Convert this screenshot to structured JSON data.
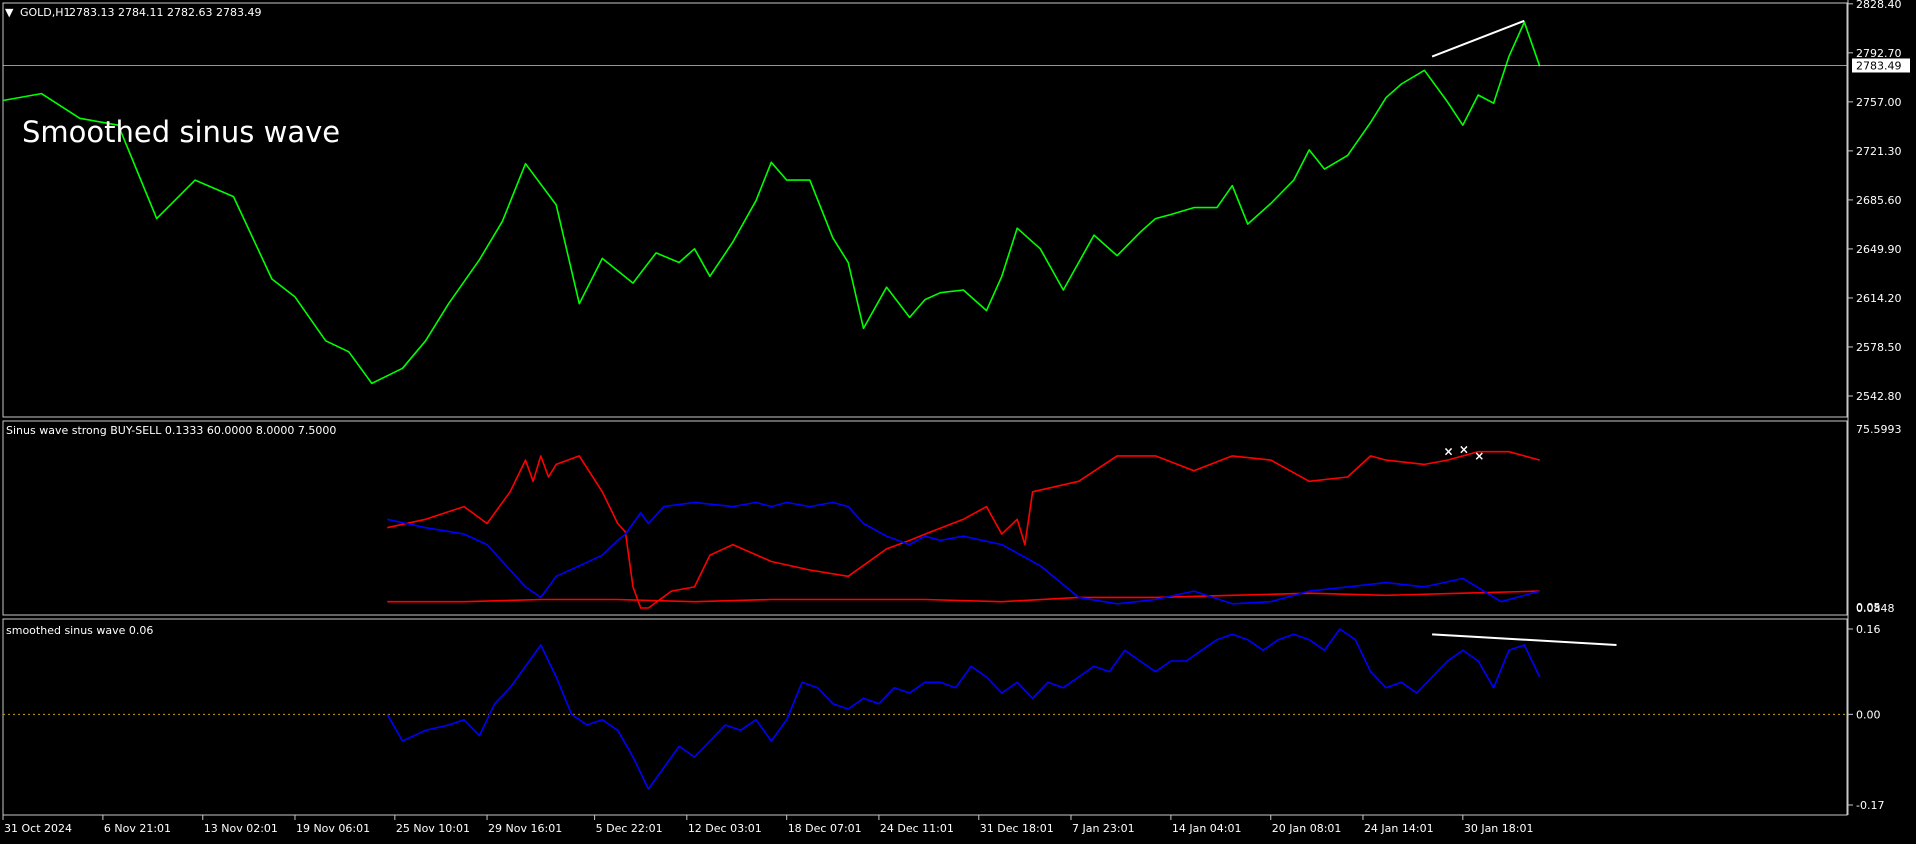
{
  "header": {
    "menu_triangle": "▼",
    "symbol": "GOLD,H1",
    "ohlc": "2783.13 2784.11 2782.63 2783.49"
  },
  "overlay_text": "Smoothed sinus wave",
  "colors": {
    "background": "#000000",
    "price": "#00ff00",
    "sell": "#ff0000",
    "buy": "#0000ff",
    "smoothed": "#0000ff",
    "axis_text": "#ffffff",
    "frame": "#c8c8c8",
    "zero_line": "#c8a000",
    "trend_line": "#ffffff"
  },
  "chart_data": [
    {
      "type": "line",
      "name": "price-panel",
      "title": "GOLD,H1",
      "ylim": [
        2527.5,
        2829
      ],
      "y_ticks": [
        "2828.40",
        "2792.70",
        "2757.00",
        "2721.30",
        "2685.60",
        "2649.90",
        "2614.20",
        "2578.50",
        "2542.80"
      ],
      "current_price": "2783.49",
      "series": [
        {
          "name": "GOLD,H1",
          "x": [
            0,
            5,
            10,
            15,
            20,
            25,
            30,
            35,
            38,
            42,
            45,
            48,
            52,
            55,
            58,
            62,
            65,
            68,
            72,
            75,
            78,
            82,
            85,
            88,
            90,
            92,
            95,
            98,
            100,
            102,
            105,
            108,
            110,
            112,
            115,
            118,
            120,
            122,
            125,
            128,
            130,
            132,
            135,
            138,
            140,
            142,
            145,
            148,
            150,
            152,
            155,
            158,
            160,
            162,
            165,
            168,
            170,
            172,
            175,
            178,
            180,
            182,
            185,
            188,
            190,
            192,
            194,
            196,
            198,
            200
          ],
          "values": [
            2758,
            2763,
            2745,
            2740,
            2672,
            2700,
            2688,
            2628,
            2615,
            2583,
            2575,
            2552,
            2563,
            2583,
            2610,
            2642,
            2670,
            2712,
            2682,
            2610,
            2643,
            2625,
            2647,
            2640,
            2650,
            2630,
            2655,
            2685,
            2713,
            2700,
            2700,
            2658,
            2640,
            2592,
            2622,
            2600,
            2613,
            2618,
            2620,
            2605,
            2630,
            2665,
            2650,
            2620,
            2640,
            2660,
            2645,
            2662,
            2672,
            2675,
            2680,
            2680,
            2696,
            2668,
            2683,
            2700,
            2722,
            2708,
            2718,
            2742,
            2760,
            2770,
            2780,
            2757,
            2740,
            2762,
            2756,
            2790,
            2815,
            2783
          ]
        }
      ],
      "trend_line": {
        "x": [
          186,
          198
        ],
        "values": [
          2790,
          2816
        ]
      }
    },
    {
      "type": "line",
      "name": "sinus-wave-panel",
      "title": "Sinus wave strong BUY-SELL 0.1333 60.0000 8.0000 7.5000",
      "y_top_label": "75.5993",
      "y_bottom_label": "0.0848",
      "y_bottom_label_overlap": "0.05",
      "ylim": [
        0,
        80
      ],
      "series": [
        {
          "name": "sell",
          "x": [
            50,
            55,
            60,
            63,
            66,
            68,
            69,
            70,
            71,
            72,
            75,
            78,
            80,
            81,
            82,
            83,
            84,
            87,
            90,
            92,
            95,
            100,
            105,
            110,
            115,
            118,
            120,
            125,
            128,
            130,
            132,
            133,
            134,
            140,
            145,
            150,
            155,
            160,
            165,
            170,
            175,
            178,
            180,
            185,
            188,
            192,
            196,
            200
          ],
          "values": [
            38,
            42,
            48,
            40,
            55,
            70,
            60,
            72,
            62,
            68,
            72,
            55,
            40,
            36,
            10,
            0,
            0,
            8,
            10,
            25,
            30,
            22,
            18,
            15,
            28,
            32,
            35,
            42,
            48,
            35,
            42,
            30,
            55,
            60,
            72,
            72,
            65,
            72,
            70,
            60,
            62,
            72,
            70,
            68,
            70,
            74,
            74,
            70
          ]
        },
        {
          "name": "sell-low",
          "x": [
            50,
            60,
            70,
            80,
            90,
            100,
            110,
            120,
            130,
            140,
            150,
            160,
            170,
            180,
            190,
            200
          ],
          "values": [
            3,
            3,
            4,
            4,
            3,
            4,
            4,
            4,
            3,
            5,
            5,
            6,
            7,
            6,
            7,
            8
          ]
        },
        {
          "name": "buy",
          "x": [
            50,
            55,
            60,
            63,
            66,
            68,
            70,
            72,
            75,
            78,
            80,
            81,
            82,
            83,
            84,
            86,
            90,
            95,
            98,
            100,
            102,
            105,
            108,
            110,
            112,
            115,
            118,
            120,
            122,
            125,
            130,
            135,
            140,
            145,
            150,
            155,
            160,
            165,
            170,
            175,
            180,
            185,
            190,
            195,
            200
          ],
          "values": [
            42,
            38,
            35,
            30,
            18,
            10,
            5,
            15,
            20,
            25,
            32,
            35,
            40,
            45,
            40,
            48,
            50,
            48,
            50,
            48,
            50,
            48,
            50,
            48,
            40,
            34,
            30,
            34,
            32,
            34,
            30,
            20,
            5,
            2,
            4,
            8,
            2,
            3,
            8,
            10,
            12,
            10,
            14,
            3,
            8
          ]
        }
      ],
      "white_marks_x": [
        188,
        190,
        192
      ],
      "white_marks_values": [
        74,
        75,
        72
      ]
    },
    {
      "type": "line",
      "name": "smoothed-panel",
      "title": "smoothed sinus wave 0.06",
      "y_ticks": [
        "0.16",
        "0.00",
        "-0.17"
      ],
      "ylim": [
        -0.17,
        0.16
      ],
      "series": [
        {
          "name": "smoothed sinus wave 0.06",
          "x": [
            50,
            52,
            55,
            58,
            60,
            62,
            64,
            66,
            68,
            70,
            72,
            74,
            76,
            78,
            80,
            82,
            84,
            86,
            88,
            90,
            92,
            94,
            96,
            98,
            100,
            102,
            104,
            106,
            108,
            110,
            112,
            114,
            116,
            118,
            120,
            122,
            124,
            126,
            128,
            130,
            132,
            134,
            136,
            138,
            140,
            142,
            144,
            146,
            148,
            150,
            152,
            154,
            156,
            158,
            160,
            162,
            164,
            166,
            168,
            170,
            172,
            174,
            176,
            178,
            180,
            182,
            184,
            186,
            188,
            190,
            192,
            194,
            196,
            198,
            200
          ],
          "values": [
            0.0,
            -0.05,
            -0.03,
            -0.02,
            -0.01,
            -0.04,
            0.02,
            0.05,
            0.09,
            0.13,
            0.07,
            0.0,
            -0.02,
            -0.01,
            -0.03,
            -0.08,
            -0.14,
            -0.1,
            -0.06,
            -0.08,
            -0.05,
            -0.02,
            -0.03,
            -0.01,
            -0.05,
            -0.01,
            0.06,
            0.05,
            0.02,
            0.01,
            0.03,
            0.02,
            0.05,
            0.04,
            0.06,
            0.06,
            0.05,
            0.09,
            0.07,
            0.04,
            0.06,
            0.03,
            0.06,
            0.05,
            0.07,
            0.09,
            0.08,
            0.12,
            0.1,
            0.08,
            0.1,
            0.1,
            0.12,
            0.14,
            0.15,
            0.14,
            0.12,
            0.14,
            0.15,
            0.14,
            0.12,
            0.16,
            0.14,
            0.08,
            0.05,
            0.06,
            0.04,
            0.07,
            0.1,
            0.12,
            0.1,
            0.05,
            0.12,
            0.13,
            0.07
          ]
        }
      ],
      "trend_line": {
        "x": [
          186,
          210
        ],
        "values": [
          0.15,
          0.13
        ]
      }
    }
  ],
  "x_axis": {
    "labels": [
      "31 Oct 2024",
      "6 Nov 21:01",
      "13 Nov 02:01",
      "19 Nov 06:01",
      "25 Nov 10:01",
      "29 Nov 16:01",
      "5 Dec 22:01",
      "12 Dec 03:01",
      "18 Dec 07:01",
      "24 Dec 11:01",
      "31 Dec 18:01",
      "7 Jan 23:01",
      "14 Jan 04:01",
      "20 Jan 08:01",
      "24 Jan 14:01",
      "30 Jan 18:01"
    ],
    "label_positions": [
      0,
      13,
      26,
      38,
      51,
      63,
      77,
      89,
      102,
      114,
      127,
      139,
      152,
      165,
      177,
      190
    ],
    "xlim": [
      0,
      240
    ]
  }
}
